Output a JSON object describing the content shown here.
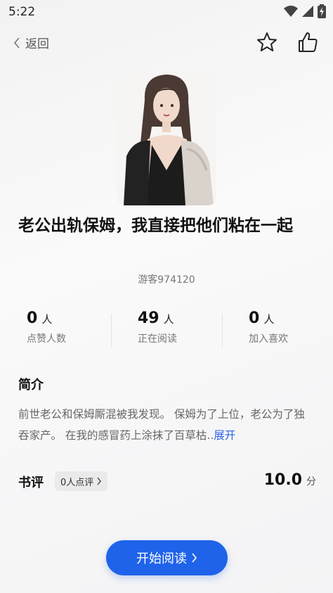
{
  "status_bar": {
    "time": "5:22",
    "icons": [
      "wifi-icon",
      "cellular-signal-icon",
      "battery-charging-icon"
    ]
  },
  "nav": {
    "back_label": "返回",
    "icons": [
      "chevron-left-icon",
      "star-outline-icon",
      "thumbs-up-outline-icon"
    ]
  },
  "book": {
    "title": "老公出轨保姆，我直接把他们粘在一起",
    "author": "游客974120"
  },
  "stats": [
    {
      "value": "0",
      "unit": "人",
      "label": "点赞人数"
    },
    {
      "value": "49",
      "unit": "人",
      "label": "正在阅读"
    },
    {
      "value": "0",
      "unit": "人",
      "label": "加入喜欢"
    }
  ],
  "intro": {
    "heading": "简介",
    "text": "前世老公和保姆厮混被我发现。 保姆为了上位，老公为了独吞家产。 在我的感冒药上涂抹了百草枯..",
    "expand_label": "展开"
  },
  "review": {
    "heading": "书评",
    "chip_label": "0人点评",
    "score": "10.0",
    "score_unit": "分"
  },
  "cta": {
    "label": "开始阅读"
  },
  "colors": {
    "accent": "#1f63ea",
    "link": "#2f63e3"
  }
}
